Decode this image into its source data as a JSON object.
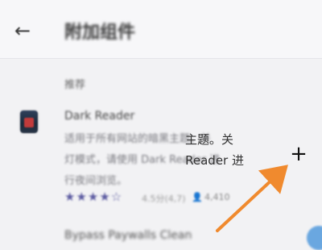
{
  "header": {
    "back_icon": "arrow-left-icon",
    "title": "附加组件"
  },
  "section": {
    "title": "推荐"
  },
  "extension": {
    "icon": "dark-reader-icon",
    "name": "Dark Reader",
    "description_line1": "适用于所有网站的暗黑主题。关",
    "description_line2": "灯模式，请使用 Dark Reader 进",
    "description_line3": "行夜间浏览。",
    "stars": "★★★★☆",
    "rating": 4.5,
    "rating_text": "4.5分(4,7)",
    "users_icon": "user-icon",
    "users_count": "4,410",
    "add_label": "+"
  },
  "next_item": {
    "text": "Bypass Paywalls Clean"
  },
  "annotation": {
    "color": "#f08a2e"
  },
  "fab": {
    "color": "#6aa7e0"
  }
}
